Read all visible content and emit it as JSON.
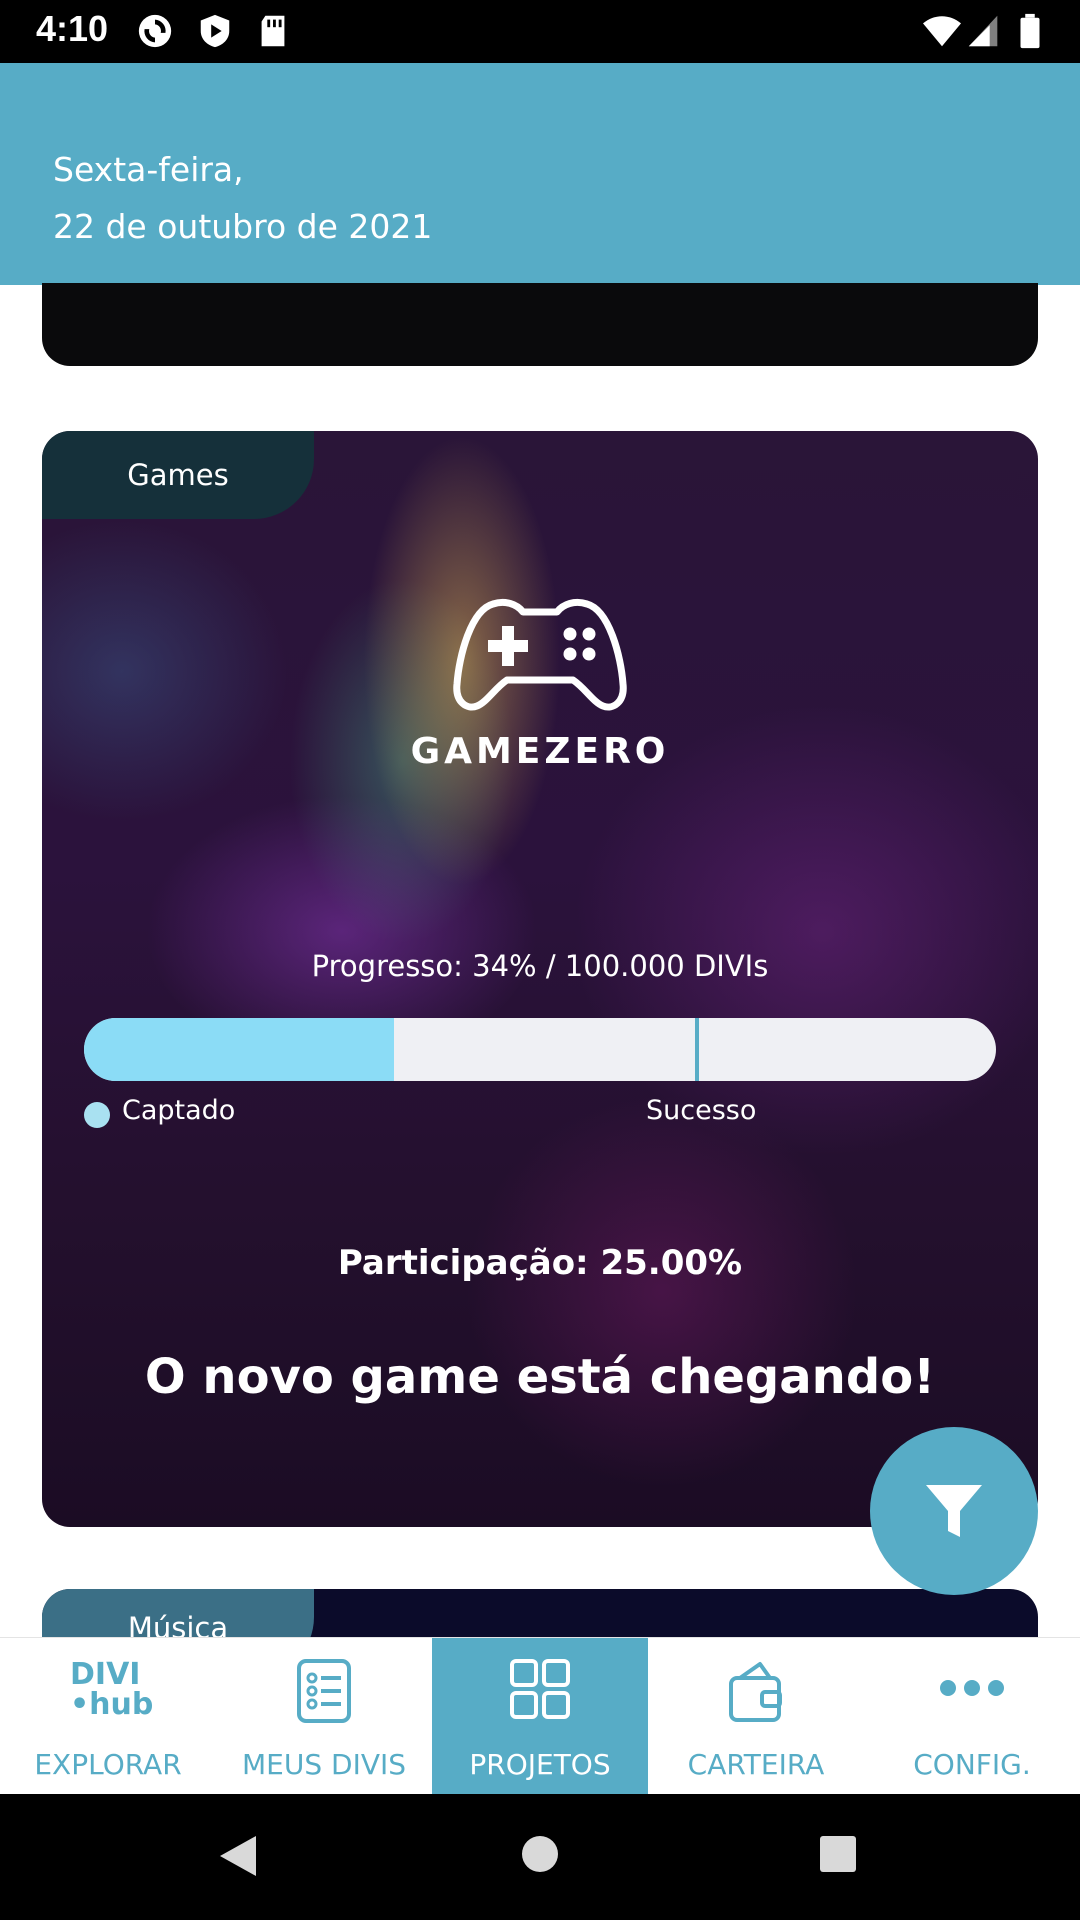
{
  "status_bar": {
    "time": "4:10"
  },
  "header": {
    "weekday": "Sexta-feira,",
    "date": "22 de outubro de 2021"
  },
  "cards": [
    {
      "category": "Games",
      "logo_text": "GAMEZERO",
      "progress_label": "Progresso: 34% / 100.000 DIVIs",
      "progress_fraction": 0.34,
      "success_marker_fraction": 0.67,
      "legend_captado": "Captado",
      "legend_sucesso": "Sucesso",
      "participation": "Participação: 25.00%",
      "title": "O novo game está chegando!"
    },
    {
      "category": "Música"
    }
  ],
  "fab": {
    "icon": "filter-icon"
  },
  "bottom_nav": {
    "brand": {
      "line1": "DIVI",
      "line2": "•hub"
    },
    "items": [
      {
        "label": "EXPLORAR",
        "icon": "divi-hub-logo",
        "active": false
      },
      {
        "label": "MEUS DIVIS",
        "icon": "list-document-icon",
        "active": false
      },
      {
        "label": "PROJETOS",
        "icon": "grid-icon",
        "active": true
      },
      {
        "label": "CARTEIRA",
        "icon": "wallet-icon",
        "active": false
      },
      {
        "label": "CONFIG.",
        "icon": "more-dots-icon",
        "active": false
      }
    ]
  },
  "colors": {
    "accent": "#57acc6",
    "progress_fill": "#8bdcf6",
    "progress_track": "#eff0f4"
  }
}
